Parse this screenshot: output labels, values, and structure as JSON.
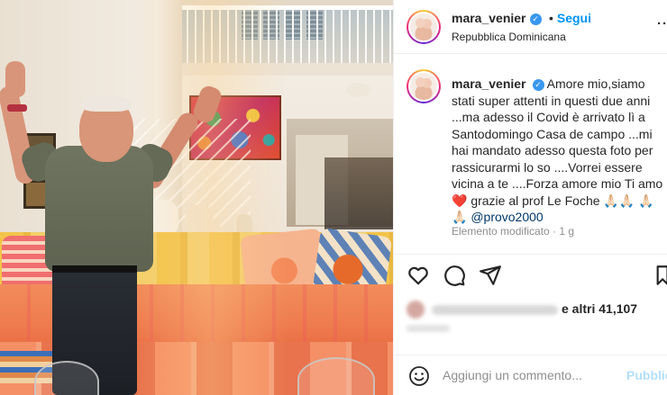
{
  "post": {
    "username": "mara_venier",
    "verified_icon": "verified-badge-icon",
    "follow_label": "Segui",
    "location": "Repubblica Dominicana",
    "more_label": "...",
    "photo_alt": "Man raising both hands in a sunlit living room",
    "caption_text": "Amore mio,siamo stati super attenti in questi due anni ...ma adesso il Covid è arrivato lì a Santodomingo Casa de campo ...mi hai mandato adesso questa foto per rassicurarmi lo so ....Vorrei essere vicina a te ....Forza amore mio Ti amo ❤️ grazie al prof Le Foche 🙏🏻🙏🏻 🙏🏻🙏🏻",
    "caption_mention": "@provo2000",
    "edited_label": "Elemento modificato",
    "edited_time": "· 1 g",
    "likes_prefix": "e altri 41,107",
    "comment_placeholder": "Aggiungi un commento...",
    "post_label": "Pubblica"
  },
  "colors": {
    "accent": "#0095f6",
    "verified": "#3897f0",
    "heart": "#ed4956",
    "post_disabled": "#b2dffc"
  }
}
